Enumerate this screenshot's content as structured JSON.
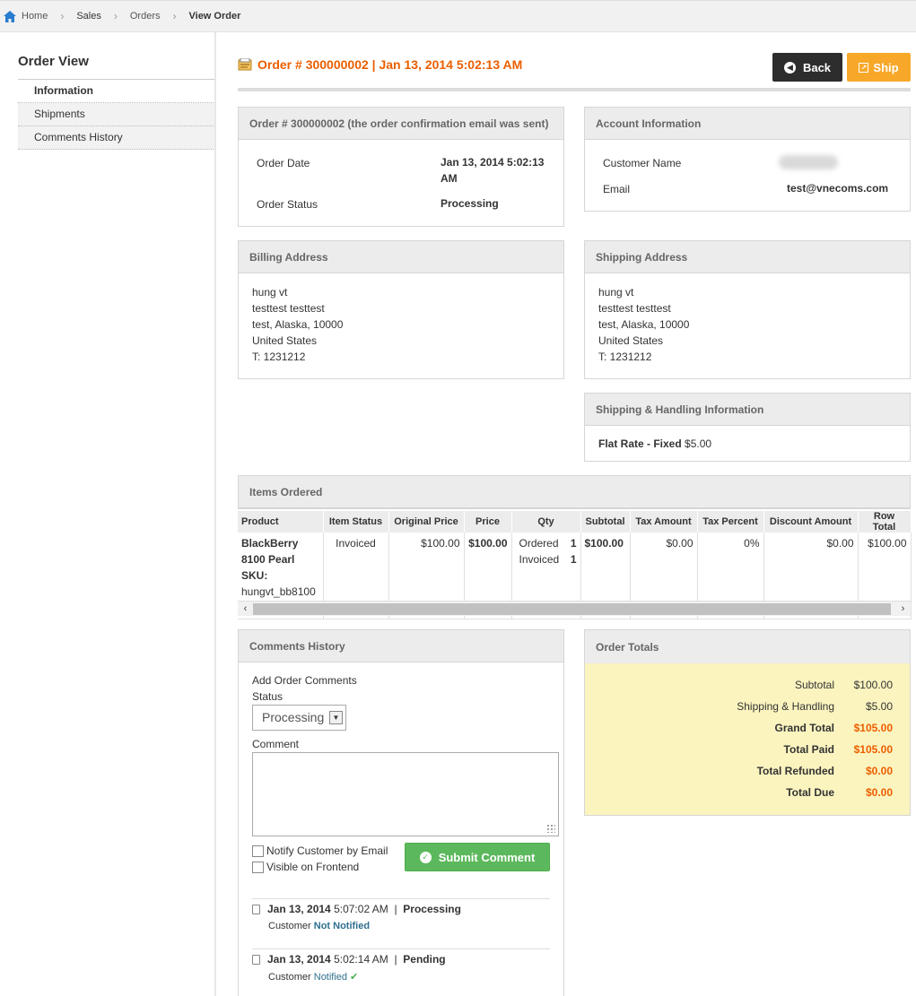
{
  "breadcrumb": {
    "home": "Home",
    "sales": "Sales",
    "orders": "Orders",
    "current": "View Order"
  },
  "sidebar": {
    "title": "Order View",
    "items": [
      {
        "label": "Information"
      },
      {
        "label": "Shipments"
      },
      {
        "label": "Comments History"
      }
    ]
  },
  "header": {
    "title": "Order # 300000002 | Jan 13, 2014 5:02:13 AM",
    "back_label": "Back",
    "ship_label": "Ship"
  },
  "order_box": {
    "title": "Order # 300000002 (the order confirmation email was sent)",
    "date_label": "Order Date",
    "date_value_1": "Jan 13, 2014 5:02:13",
    "date_value_2": "AM",
    "status_label": "Order Status",
    "status_value": "Processing"
  },
  "account_box": {
    "title": "Account Information",
    "name_label": "Customer Name",
    "email_label": "Email",
    "email_value": "test@vnecoms.com"
  },
  "billing": {
    "title": "Billing Address",
    "lines": [
      "hung vt",
      "testtest testtest",
      "test, Alaska, 10000",
      "United States",
      "T: 1231212"
    ]
  },
  "shipping": {
    "title": "Shipping Address",
    "lines": [
      "hung vt",
      "testtest testtest",
      "test, Alaska, 10000",
      "United States",
      "T: 1231212"
    ]
  },
  "shipping_method": {
    "title": "Shipping & Handling Information",
    "method": "Flat Rate - Fixed",
    "price": "$5.00"
  },
  "items": {
    "title": "Items Ordered",
    "columns": [
      "Product",
      "Item Status",
      "Original Price",
      "Price",
      "Qty",
      "Subtotal",
      "Tax Amount",
      "Tax Percent",
      "Discount Amount",
      "Row Total"
    ],
    "row": {
      "product_1": "BlackBerry",
      "product_2": "8100 Pearl",
      "sku_label": "SKU:",
      "sku": "hungvt_bb8100",
      "status": "Invoiced",
      "original_price": "$100.00",
      "price": "$100.00",
      "qty_ordered_label": "Ordered",
      "qty_ordered": "1",
      "qty_invoiced_label": "Invoiced",
      "qty_invoiced": "1",
      "subtotal": "$100.00",
      "tax_amount": "$0.00",
      "tax_percent": "0%",
      "discount": "$0.00",
      "row_total": "$100.00"
    }
  },
  "comments": {
    "title": "Comments History",
    "add_label": "Add Order Comments",
    "status_label": "Status",
    "status_value": "Processing",
    "comment_label": "Comment",
    "notify_label": "Notify Customer by Email",
    "visible_label": "Visible on Frontend",
    "submit_label": "Submit Comment",
    "history": [
      {
        "date": "Jan 13, 2014",
        "time": "5:07:02 AM",
        "sep": "|",
        "status": "Processing",
        "customer": "Customer",
        "notified": "Not Notified"
      },
      {
        "date": "Jan 13, 2014",
        "time": "5:02:14 AM",
        "sep": "|",
        "status": "Pending",
        "customer": "Customer",
        "notified": "Notified"
      }
    ]
  },
  "totals": {
    "title": "Order Totals",
    "rows": [
      {
        "label": "Subtotal",
        "value": "$100.00"
      },
      {
        "label": "Shipping & Handling",
        "value": "$5.00"
      },
      {
        "label": "Grand Total",
        "value": "$105.00"
      },
      {
        "label": "Total Paid",
        "value": "$105.00"
      },
      {
        "label": "Total Refunded",
        "value": "$0.00"
      },
      {
        "label": "Total Due",
        "value": "$0.00"
      }
    ]
  },
  "colors": {
    "accent": "#eb5e00",
    "ship": "#f7a829",
    "submit": "#5cb85c",
    "totals_bg": "#fbf4bf"
  }
}
